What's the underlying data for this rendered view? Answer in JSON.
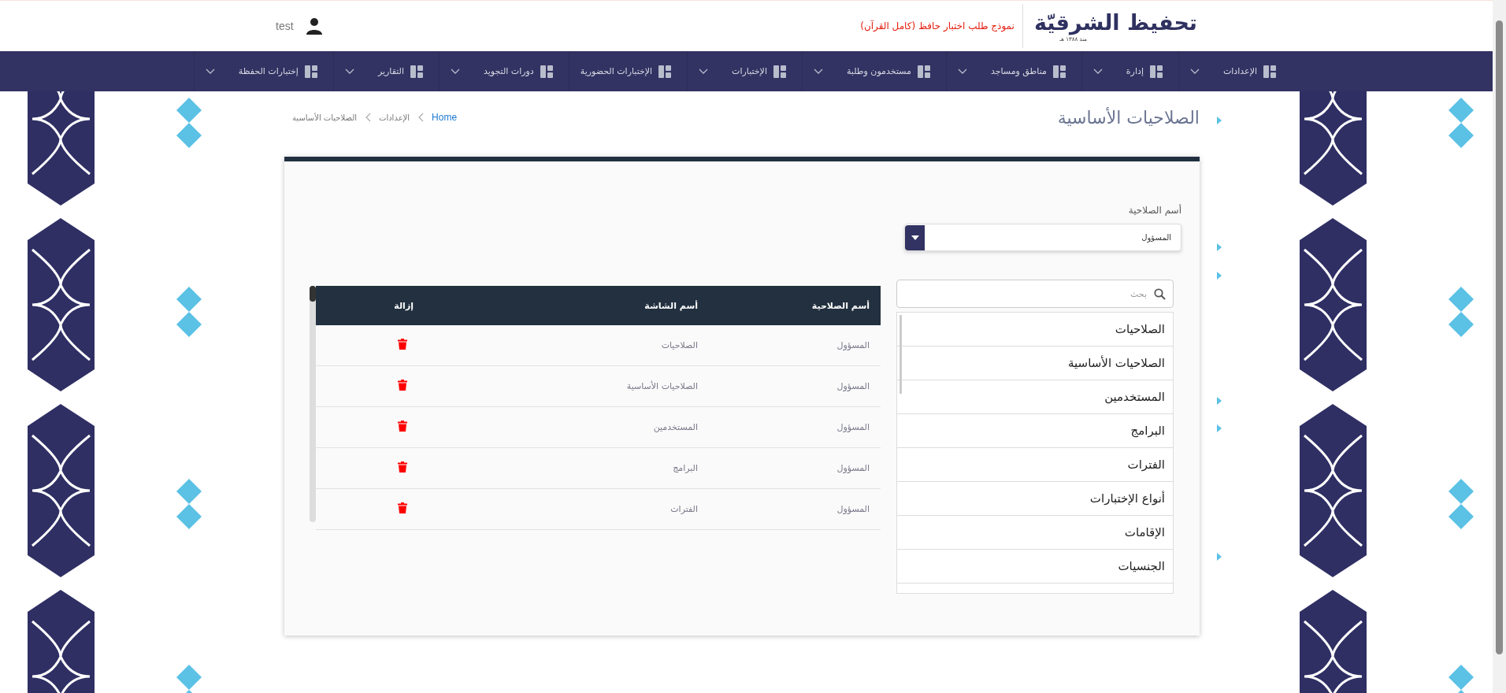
{
  "header": {
    "logo_title": "تحفيظ الشرقيّة",
    "logo_subtitle": "منذ ١٣٨٨ هـ",
    "notice": "نموذج طلب اختبار حافظ (كامل القرآن)",
    "user": "test"
  },
  "nav": [
    {
      "label": "الإعدادات",
      "has_menu": true
    },
    {
      "label": "إدارة",
      "has_menu": true
    },
    {
      "label": "مناطق ومساجد",
      "has_menu": true
    },
    {
      "label": "مستخدمون وطلبة",
      "has_menu": true
    },
    {
      "label": "الإختبارات",
      "has_menu": true
    },
    {
      "label": "الإختبارات الحضورية",
      "has_menu": false
    },
    {
      "label": "دورات التجويد",
      "has_menu": true
    },
    {
      "label": "التقارير",
      "has_menu": true
    },
    {
      "label": "إختبارات الحفظة",
      "has_menu": true
    }
  ],
  "page_title": "الصلاحيات الأساسية",
  "breadcrumb": [
    {
      "label": "Home",
      "kind": "link"
    },
    {
      "label": "الإعدادات",
      "kind": "text"
    },
    {
      "label": "الصلاحيات الأساسية",
      "kind": "text"
    }
  ],
  "form": {
    "label": "أسم الصلاحية",
    "select_value": "المسؤول"
  },
  "screens": {
    "search_placeholder": "بحث",
    "items": [
      "الصلاحيات",
      "الصلاحيات الأساسية",
      "المستخدمين",
      "البرامج",
      "الفترات",
      "أنواع الإختبارات",
      "الإقامات",
      "الجنسيات"
    ]
  },
  "table": {
    "columns": [
      "أسم الصلاحية",
      "أسم الشاشة",
      "إزالة"
    ],
    "rows": [
      {
        "role": "المسؤول",
        "screen": "الصلاحيات"
      },
      {
        "role": "المسؤول",
        "screen": "الصلاحيات الأساسية"
      },
      {
        "role": "المسؤول",
        "screen": "المستخدمين"
      },
      {
        "role": "المسؤول",
        "screen": "البرامج"
      },
      {
        "role": "المسؤول",
        "screen": "الفترات"
      }
    ]
  }
}
